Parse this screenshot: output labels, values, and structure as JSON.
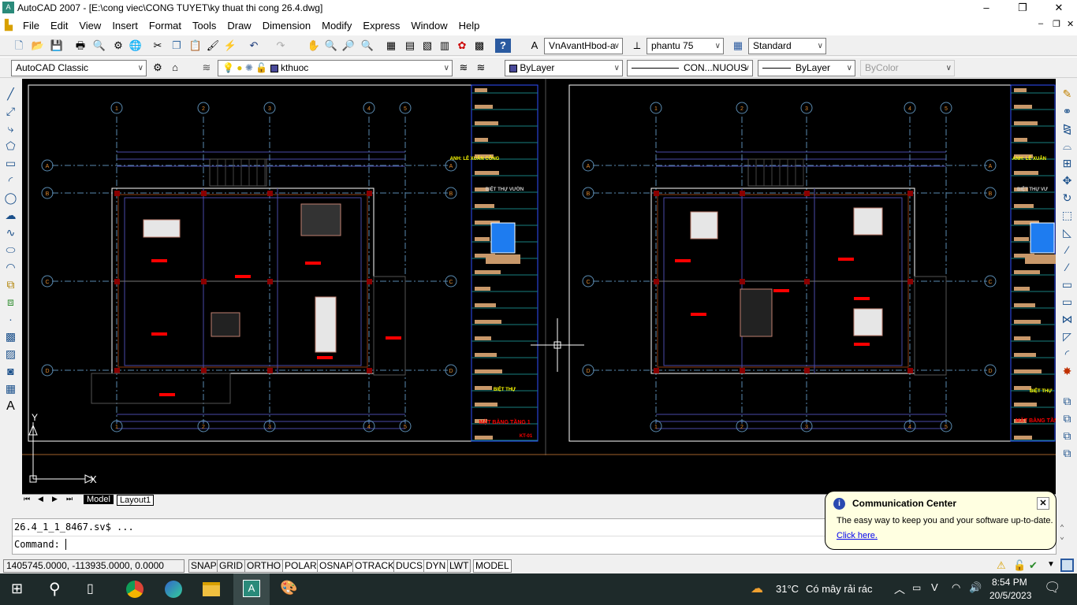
{
  "window": {
    "title": "AutoCAD 2007 - [E:\\cong viec\\CONG TUYET\\ky thuat thi cong 26.4.dwg]",
    "minimize": "–",
    "restore": "❐",
    "close": "✕"
  },
  "menu": [
    "File",
    "Edit",
    "View",
    "Insert",
    "Format",
    "Tools",
    "Draw",
    "Dimension",
    "Modify",
    "Express",
    "Window",
    "Help"
  ],
  "toolbar": {
    "text_style": "VnAvantHbod-a",
    "dim_style": "phantu 75",
    "table_style": "Standard",
    "workspace": "AutoCAD Classic",
    "layer": "kthuoc",
    "color": "ByLayer",
    "linetype": "CON...NUOUS",
    "lineweight": "ByLayer",
    "plotstyle": "ByColor"
  },
  "drawing": {
    "grid_cols": [
      "1",
      "2",
      "3",
      "4",
      "5"
    ],
    "grid_rows": [
      "A",
      "B",
      "C",
      "D"
    ],
    "left_sheet": {
      "owner": "ANH: LÊ XUÂN CÔNG",
      "project": "BIỆT THỰ VƯỜN",
      "type": "BIỆT THỰ",
      "sheet_title": "MẶT BẰNG TẦNG 1",
      "sheet_no": "KT-01"
    },
    "right_sheet": {
      "owner": "ANH: LÊ XUÂN",
      "project": "BIỆT THỰ VƯ",
      "type": "BIỆT THỰ",
      "sheet_title": "MẶT BẰNG TẦNG"
    },
    "ucs": {
      "x": "X",
      "y": "Y"
    }
  },
  "layout_tabs": [
    "Model",
    "Layout1"
  ],
  "command": {
    "history": "26.4_1_1_8467.sv$ ...",
    "prompt": "Command:"
  },
  "status": {
    "coords": "1405745.0000, -113935.0000, 0.0000",
    "toggles": [
      "SNAP",
      "GRID",
      "ORTHO",
      "POLAR",
      "OSNAP",
      "OTRACK",
      "DUCS",
      "DYN",
      "LWT",
      "MODEL"
    ]
  },
  "balloon": {
    "title": "Communication Center",
    "text": "The easy way to keep you and your software up-to-date.",
    "link": "Click here.",
    "close": "✕"
  },
  "taskbar": {
    "weather_temp": "31°C",
    "weather_text": "Có mây rải rác",
    "time": "8:54 PM",
    "date": "20/5/2023"
  },
  "colors": {
    "canvas": "#000000",
    "grid": "#4a4aa8",
    "axis": "#5a8ab0",
    "title_yellow": "#ffff00",
    "title_red": "#ff0000",
    "taskbar": "#1e2a2a"
  }
}
